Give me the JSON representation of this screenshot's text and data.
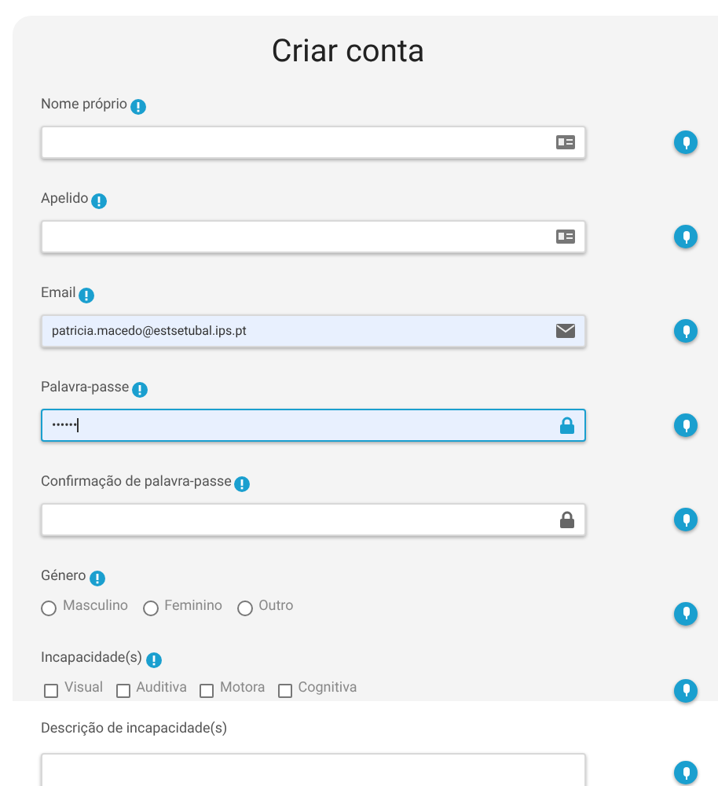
{
  "title": "Criar conta",
  "fields": [
    {
      "kind": "name",
      "label": "Nome próprio",
      "info": true,
      "autofilled": false,
      "focused": false
    },
    {
      "kind": "name",
      "label": "Apelido",
      "info": true,
      "autofilled": false,
      "focused": false
    },
    {
      "kind": "email",
      "label": "Email",
      "info": true,
      "value": "patricia.macedo@estsetubal.ips.pt",
      "autofilled": true,
      "focused": false
    },
    {
      "kind": "password",
      "label": "Palavra-passe",
      "info": true,
      "value": "••••••",
      "autofilled": true,
      "focused": true
    },
    {
      "kind": "password",
      "label": "Confirmação de palavra-passe",
      "info": true,
      "autofilled": false,
      "focused": false
    },
    {
      "kind": "radio",
      "label": "Género",
      "info": true,
      "options": [
        {
          "label": "Masculino",
          "selected": false
        },
        {
          "label": "Feminino",
          "selected": false
        },
        {
          "label": "Outro",
          "selected": false
        }
      ]
    },
    {
      "kind": "checkbox",
      "label": "Incapacidade(s)",
      "info": true,
      "options": [
        {
          "label": "Visual",
          "checked": false
        },
        {
          "label": "Auditiva",
          "checked": false
        },
        {
          "label": "Motora",
          "checked": false
        },
        {
          "label": "Cognitiva",
          "checked": false
        }
      ]
    },
    {
      "kind": "textarea",
      "label": "Descrição de incapacidade(s)",
      "info": false
    }
  ]
}
